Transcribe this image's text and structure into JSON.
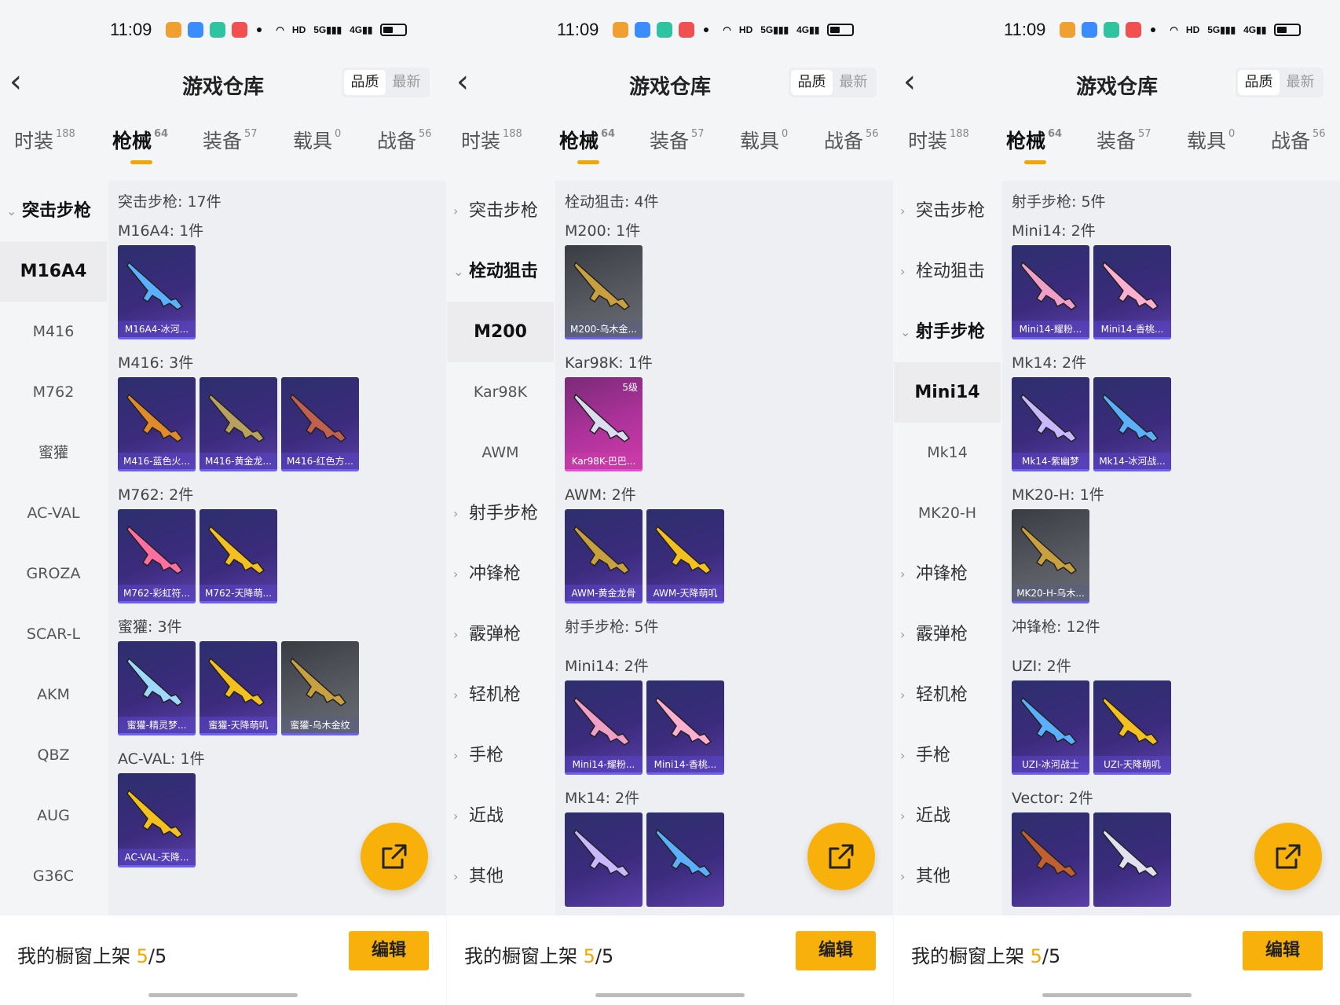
{
  "status": {
    "time": "11:09"
  },
  "header": {
    "title": "游戏仓库",
    "sort_quality": "品质",
    "sort_latest": "最新"
  },
  "tabs": [
    {
      "label": "时装",
      "count": "188"
    },
    {
      "label": "枪械",
      "count": "64"
    },
    {
      "label": "装备",
      "count": "57"
    },
    {
      "label": "载具",
      "count": "0"
    },
    {
      "label": "战备",
      "count": "56"
    }
  ],
  "bottom": {
    "showcase_label": "我的橱窗上架 ",
    "showcase_count": "5",
    "showcase_total": "/5",
    "edit_label": "编辑"
  },
  "colors": {
    "accent": "#f5a400",
    "fab": "#f7b10a"
  },
  "panels": [
    {
      "sidebar": [
        {
          "type": "group",
          "label": "突击步枪",
          "open": true,
          "chev": "⌄"
        },
        {
          "type": "item",
          "label": "M16A4",
          "selected": true
        },
        {
          "type": "item",
          "label": "M416"
        },
        {
          "type": "item",
          "label": "M762"
        },
        {
          "type": "item",
          "label": "蜜獾"
        },
        {
          "type": "item",
          "label": "AC-VAL"
        },
        {
          "type": "item",
          "label": "GROZA"
        },
        {
          "type": "item",
          "label": "SCAR-L"
        },
        {
          "type": "item",
          "label": "AKM"
        },
        {
          "type": "item",
          "label": "QBZ"
        },
        {
          "type": "item",
          "label": "AUG"
        },
        {
          "type": "item",
          "label": "G36C"
        }
      ],
      "section_title": "突击步枪: 17件",
      "groups": [
        {
          "title": "M16A4: 1件",
          "items": [
            {
              "label": "M16A4-冰河...",
              "style": "purple",
              "gun": "#5ab0ff"
            }
          ]
        },
        {
          "title": "M416: 3件",
          "items": [
            {
              "label": "M416-蓝色火...",
              "style": "purple",
              "gun": "#e08a2a"
            },
            {
              "label": "M416-黄金龙...",
              "style": "purple",
              "gun": "#b8a060"
            },
            {
              "label": "M416-红色方...",
              "style": "purple",
              "gun": "#c06050"
            }
          ]
        },
        {
          "title": "M762: 2件",
          "items": [
            {
              "label": "M762-彩虹符...",
              "style": "purple",
              "gun": "#ff6fa0"
            },
            {
              "label": "M762-天降萌...",
              "style": "purple",
              "gun": "#f4c020"
            }
          ]
        },
        {
          "title": "蜜獾: 3件",
          "items": [
            {
              "label": "蜜獾-精灵梦...",
              "style": "purple",
              "gun": "#9fd8ff"
            },
            {
              "label": "蜜獾-天降萌叽",
              "style": "purple",
              "gun": "#f4c020"
            },
            {
              "label": "蜜獾-乌木金纹",
              "style": "gray",
              "gun": "#c8a040"
            }
          ]
        },
        {
          "title": "AC-VAL: 1件",
          "items": [
            {
              "label": "AC-VAL-天降...",
              "style": "purple",
              "gun": "#f4c020"
            }
          ]
        }
      ]
    },
    {
      "sidebar": [
        {
          "type": "group",
          "label": "突击步枪",
          "open": false,
          "chev": "›"
        },
        {
          "type": "group",
          "label": "栓动狙击",
          "open": true,
          "chev": "⌄"
        },
        {
          "type": "item",
          "label": "M200",
          "selected": true
        },
        {
          "type": "item",
          "label": "Kar98K"
        },
        {
          "type": "item",
          "label": "AWM"
        },
        {
          "type": "group",
          "label": "射手步枪",
          "open": false,
          "chev": "›"
        },
        {
          "type": "group",
          "label": "冲锋枪",
          "open": false,
          "chev": "›"
        },
        {
          "type": "group",
          "label": "霰弹枪",
          "open": false,
          "chev": "›"
        },
        {
          "type": "group",
          "label": "轻机枪",
          "open": false,
          "chev": "›"
        },
        {
          "type": "group",
          "label": "手枪",
          "open": false,
          "chev": "›"
        },
        {
          "type": "group",
          "label": "近战",
          "open": false,
          "chev": "›"
        },
        {
          "type": "group",
          "label": "其他",
          "open": false,
          "chev": "›"
        }
      ],
      "section_title": "栓动狙击: 4件",
      "groups": [
        {
          "title": "M200: 1件",
          "items": [
            {
              "label": "M200-乌木金...",
              "style": "gray",
              "gun": "#c8a040"
            }
          ]
        },
        {
          "title": "Kar98K: 1件",
          "items": [
            {
              "label": "Kar98K-巴巴...",
              "style": "pink",
              "gun": "#dcdcf0",
              "level": "5级"
            }
          ]
        },
        {
          "title": "AWM: 2件",
          "items": [
            {
              "label": "AWM-黄金龙骨",
              "style": "purple",
              "gun": "#c8a040"
            },
            {
              "label": "AWM-天降萌叽",
              "style": "purple",
              "gun": "#f4c020"
            }
          ]
        },
        {
          "title": "射手步枪: 5件",
          "section": true,
          "items": []
        },
        {
          "title": "Mini14: 2件",
          "items": [
            {
              "label": "Mini14-耀粉...",
              "style": "purple",
              "gun": "#f0a0c8"
            },
            {
              "label": "Mini14-香桃...",
              "style": "purple",
              "gun": "#ffb0d0"
            }
          ]
        },
        {
          "title": "Mk14: 2件",
          "items": [
            {
              "label": "",
              "style": "purple",
              "gun": "#c8b8ff"
            },
            {
              "label": "",
              "style": "purple",
              "gun": "#5ab0ff"
            }
          ]
        }
      ]
    },
    {
      "sidebar": [
        {
          "type": "group",
          "label": "突击步枪",
          "open": false,
          "chev": "›"
        },
        {
          "type": "group",
          "label": "栓动狙击",
          "open": false,
          "chev": "›"
        },
        {
          "type": "group",
          "label": "射手步枪",
          "open": true,
          "chev": "⌄"
        },
        {
          "type": "item",
          "label": "Mini14",
          "selected": true
        },
        {
          "type": "item",
          "label": "Mk14"
        },
        {
          "type": "item",
          "label": "MK20-H"
        },
        {
          "type": "group",
          "label": "冲锋枪",
          "open": false,
          "chev": "›"
        },
        {
          "type": "group",
          "label": "霰弹枪",
          "open": false,
          "chev": "›"
        },
        {
          "type": "group",
          "label": "轻机枪",
          "open": false,
          "chev": "›"
        },
        {
          "type": "group",
          "label": "手枪",
          "open": false,
          "chev": "›"
        },
        {
          "type": "group",
          "label": "近战",
          "open": false,
          "chev": "›"
        },
        {
          "type": "group",
          "label": "其他",
          "open": false,
          "chev": "›"
        }
      ],
      "section_title": "射手步枪: 5件",
      "groups": [
        {
          "title": "Mini14: 2件",
          "items": [
            {
              "label": "Mini14-耀粉...",
              "style": "purple",
              "gun": "#f0a0c8"
            },
            {
              "label": "Mini14-香桃...",
              "style": "purple",
              "gun": "#ffb0d0"
            }
          ]
        },
        {
          "title": "Mk14: 2件",
          "items": [
            {
              "label": "Mk14-紫幽梦",
              "style": "purple",
              "gun": "#c8b8ff"
            },
            {
              "label": "Mk14-冰河战...",
              "style": "purple",
              "gun": "#5ab0ff"
            }
          ]
        },
        {
          "title": "MK20-H: 1件",
          "items": [
            {
              "label": "MK20-H-乌木...",
              "style": "gray",
              "gun": "#c8a040"
            }
          ]
        },
        {
          "title": "冲锋枪: 12件",
          "section": true,
          "items": []
        },
        {
          "title": "UZI: 2件",
          "items": [
            {
              "label": "UZI-冰河战士",
              "style": "purple",
              "gun": "#5ab0ff"
            },
            {
              "label": "UZI-天降萌叽",
              "style": "purple",
              "gun": "#f4c020"
            }
          ]
        },
        {
          "title": "Vector: 2件",
          "items": [
            {
              "label": "",
              "style": "purple",
              "gun": "#c06030"
            },
            {
              "label": "",
              "style": "purple",
              "gun": "#e0e0f0"
            }
          ]
        }
      ]
    }
  ]
}
